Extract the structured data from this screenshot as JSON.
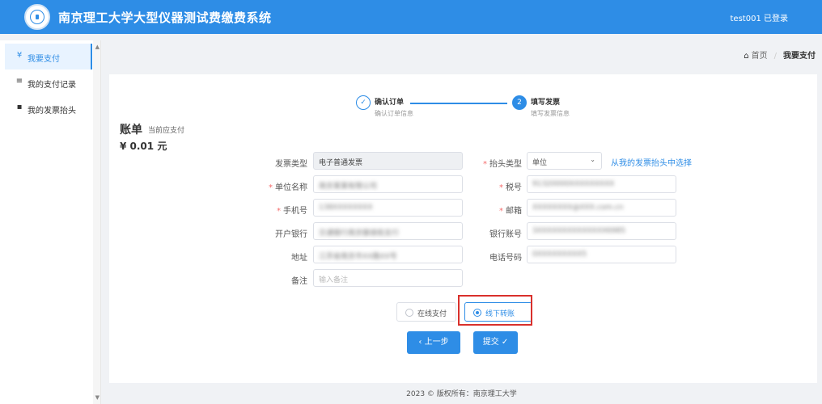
{
  "header": {
    "title": "南京理工大学大型仪器测试费缴费系统",
    "user_status": "test001 已登录"
  },
  "sidebar": {
    "items": [
      {
        "icon": "¥",
        "label": "我要支付",
        "active": true
      },
      {
        "icon": "≡",
        "label": "我的支付记录",
        "active": false
      },
      {
        "icon": "▪",
        "label": "我的发票抬头",
        "active": false
      }
    ]
  },
  "breadcrumb": {
    "home": "首页",
    "current": "我要支付"
  },
  "steps": [
    {
      "title": "确认订单",
      "desc": "确认订单信息",
      "status": "done",
      "icon": "check-icon"
    },
    {
      "number": "2",
      "title": "填写发票",
      "desc": "填写发票信息",
      "status": "active"
    }
  ],
  "bill": {
    "title": "账单",
    "subtitle": "当前应支付",
    "amount": "¥ 0.01 元"
  },
  "form": {
    "invoice_type_label": "发票类型",
    "invoice_type_value": "电子普通发票",
    "header_type_label": "抬头类型",
    "header_type_value": "单位",
    "choose_header_link": "从我的发票抬头中选择",
    "company_name_label": "单位名称",
    "company_name_value": "南京某某有限公司",
    "tax_no_label": "税号",
    "tax_no_value": "91320000XXXXXXXXX",
    "phone_label": "手机号",
    "phone_value": "138XXXXXXXX",
    "email_label": "邮箱",
    "email_value": "XXXXXXXX@XXX.com.cn",
    "bank_label": "开户银行",
    "bank_value": "交通银行南京御道街支行",
    "bank_account_label": "银行账号",
    "bank_account_value": "3XXXXXXXXXXXXXX6985",
    "address_label": "地址",
    "address_value": "江苏省南京市XX路XX号",
    "tel_label": "电话号码",
    "tel_value": "0XXXXXXXXX5",
    "remark_label": "备注",
    "remark_placeholder": "输入备注"
  },
  "payment": {
    "online_label": "在线支付",
    "offline_label": "线下转账",
    "selected": "offline",
    "highlight_color": "#d9302c"
  },
  "buttons": {
    "prev_label": "‹ 上一步",
    "submit_label": "提交 ✓"
  },
  "footer": {
    "copyright": "2023 © 版权所有：南京理工大学"
  },
  "colors": {
    "primary": "#2e8de6",
    "required": "#f56c6c"
  }
}
